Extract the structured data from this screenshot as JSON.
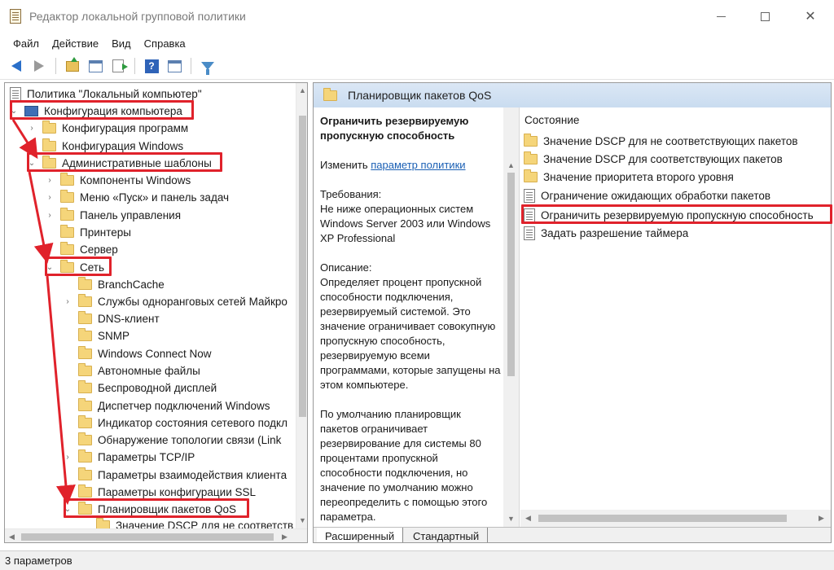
{
  "window": {
    "title": "Редактор локальной групповой политики"
  },
  "menu": [
    "Файл",
    "Действие",
    "Вид",
    "Справка"
  ],
  "toolbar": {
    "buttons": [
      "back-icon",
      "forward-icon",
      "folder-up-icon",
      "show-pane-icon",
      "export-icon",
      "help-icon",
      "extended-view-icon",
      "filter-icon"
    ]
  },
  "tree": {
    "root": "Политика \"Локальный компьютер\"",
    "items": [
      "Конфигурация компьютера",
      "Конфигурация программ",
      "Конфигурация Windows",
      "Административные шаблоны",
      "Компоненты Windows",
      "Меню «Пуск» и панель задач",
      "Панель управления",
      "Принтеры",
      "Сервер",
      "Сеть",
      "BranchCache",
      "Службы одноранговых сетей Майкро",
      "DNS-клиент",
      "SNMP",
      "Windows Connect Now",
      "Автономные файлы",
      "Беспроводной дисплей",
      "Диспетчер подключений Windows",
      "Индикатор состояния сетевого подкл",
      "Обнаружение топологии связи (Link",
      "Параметры TCP/IP",
      "Параметры взаимодействия клиента",
      "Параметры конфигурации SSL",
      "Планировщик пакетов QoS",
      "Значение DSCP для не соответств"
    ]
  },
  "right": {
    "header_title": "Планировщик пакетов QoS",
    "description": {
      "title": "Ограничить резервируемую пропускную способность",
      "edit_prefix": "Изменить",
      "edit_link": "параметр политики",
      "requirements": "Требования:\nНе ниже операционных систем Windows Server 2003 или Windows XP Professional",
      "description": "Описание:\nОпределяет процент пропускной способности подключения, резервируемый системой. Это значение ограничивает совокупную пропускную способность, резервируемую всеми программами, которые запущены на этом компьютере.",
      "default_note": "По умолчанию планировщик пакетов ограничивает резервирование для системы 80 процентами пропускной способности подключения, но значение по умолчанию можно переопределить с помощью этого параметра."
    },
    "list_header": "Состояние",
    "list_items": [
      "Значение DSCP для не соответствующих пакетов",
      "Значение DSCP для соответствующих пакетов",
      "Значение приоритета второго уровня",
      "Ограничение ожидающих обработки пакетов",
      "Ограничить резервируемую пропускную способность",
      "Задать разрешение таймера"
    ],
    "tabs": [
      "Расширенный",
      "Стандартный"
    ]
  },
  "status": "3 параметров",
  "colors": {
    "highlight": "#e0222b",
    "link": "#1a5fb4",
    "folder": "#f5d57a"
  }
}
